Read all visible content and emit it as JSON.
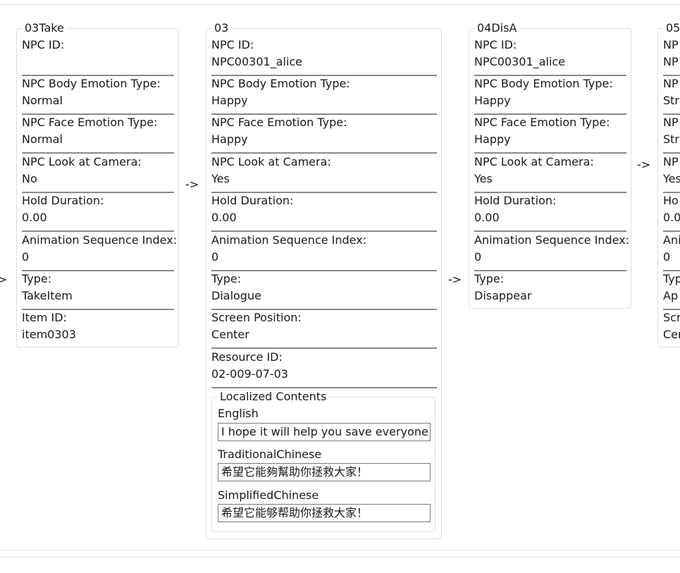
{
  "arrow": "->",
  "labels": {
    "npc_id": "NPC ID:",
    "body_emotion": "NPC Body Emotion Type:",
    "face_emotion": "NPC Face Emotion Type:",
    "look_camera": "NPC Look at Camera:",
    "hold_duration": "Hold Duration:",
    "anim_index": "Animation Sequence Index:",
    "type": "Type:",
    "item_id": "Item ID:",
    "screen_position": "Screen Position:",
    "resource_id": "Resource ID:"
  },
  "cards": [
    {
      "title": "03Take",
      "npc_id": "",
      "body_emotion": "Normal",
      "face_emotion": "Normal",
      "look_camera": "No",
      "hold_duration": "0.00",
      "anim_index": "0",
      "type": "TakeItem",
      "item_id": "item0303"
    },
    {
      "title": "03",
      "npc_id": "NPC00301_alice",
      "body_emotion": "Happy",
      "face_emotion": "Happy",
      "look_camera": "Yes",
      "hold_duration": "0.00",
      "anim_index": "0",
      "type": "Dialogue",
      "screen_position": "Center",
      "resource_id": "02-009-07-03",
      "localized": {
        "title": "Localized Contents",
        "entries": [
          {
            "language": "English",
            "text": "I hope it will help you save everyone!"
          },
          {
            "language": "TraditionalChinese",
            "text": "希望它能夠幫助你拯救大家！"
          },
          {
            "language": "SimplifiedChinese",
            "text": "希望它能够帮助你拯救大家！"
          }
        ]
      }
    },
    {
      "title": "04DisA",
      "npc_id": "NPC00301_alice",
      "body_emotion": "Happy",
      "face_emotion": "Happy",
      "look_camera": "Yes",
      "hold_duration": "0.00",
      "anim_index": "0",
      "type": "Disappear"
    },
    {
      "title": "05",
      "npc_id_partial": "NP",
      "npc_id_value_partial": "NP",
      "body_partial": "NP",
      "body_value_partial": "Stri",
      "face_partial": "NP",
      "face_value_partial": "Stri",
      "look_partial": "NP",
      "look_value_partial": "Yes",
      "hold_partial": "Ho",
      "hold_value_partial": "0.0",
      "anim_partial": "Ani",
      "anim_value_partial": "0",
      "type_partial": "Typ",
      "type_value_partial": "Ap",
      "screen_partial": "Scr",
      "screen_value_partial": "Cer"
    }
  ]
}
